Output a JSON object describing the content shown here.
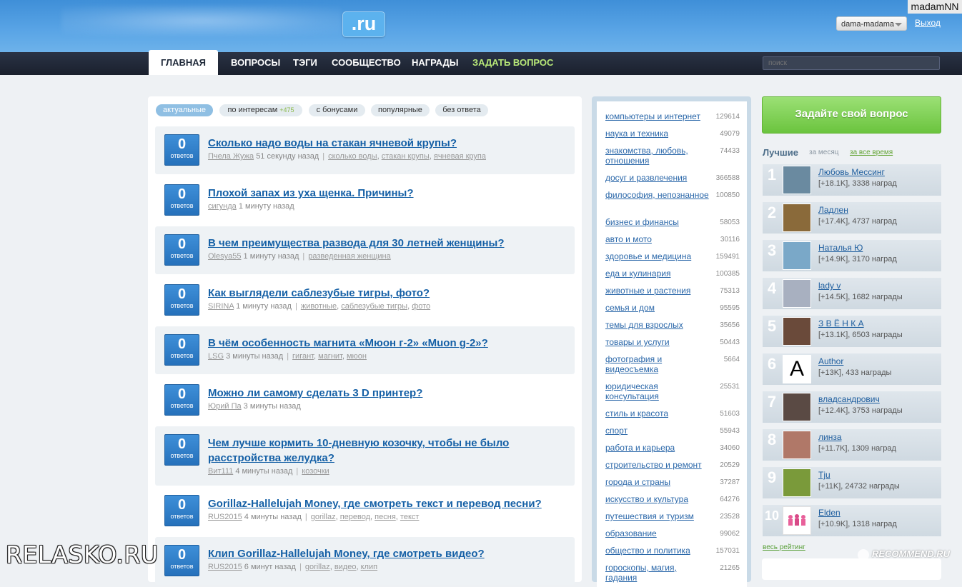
{
  "header": {
    "logo_tld": ".ru",
    "watermark_user": "madamNN",
    "user_menu_label": "dama-madama",
    "logout_label": "Выход"
  },
  "nav": {
    "home": "Главная",
    "questions": "Вопросы",
    "tags": "Тэги",
    "community": "Сообщество",
    "awards": "Награды",
    "ask": "Задать вопрос",
    "search_placeholder": "поиск"
  },
  "filters": {
    "actual": "актуальные",
    "interests": "по интересам",
    "interests_count": "+475",
    "bonus": "с бонусами",
    "popular": "популярные",
    "unanswered": "без ответа"
  },
  "questions": [
    {
      "answers": "0",
      "answers_label": "ответов",
      "title": "Сколько надо воды на стакан ячневой крупы?",
      "author": "Пчела Жужа",
      "time": "51 секунду назад",
      "tags": [
        "сколько воды",
        "стакан крупы",
        "ячневая крупа"
      ]
    },
    {
      "answers": "0",
      "answers_label": "ответов",
      "title": "Плохой запах из уха щенка. Причины?",
      "author": "сигунда",
      "time": "1 минуту назад",
      "tags": []
    },
    {
      "answers": "0",
      "answers_label": "ответов",
      "title": "В чем преимущества развода для 30 летней женщины?",
      "author": "Olesya55",
      "time": "1 минуту назад",
      "tags": [
        "разведенная женщина"
      ]
    },
    {
      "answers": "0",
      "answers_label": "ответов",
      "title": "Как выглядели саблезубые тигры, фото?",
      "author": "SIRINA",
      "time": "1 минуту назад",
      "tags": [
        "животные",
        "саблезубые тигры",
        "фото"
      ]
    },
    {
      "answers": "0",
      "answers_label": "ответов",
      "title": "В чём особенность магнита «Мюон г-2» «Muon g-2»?",
      "author": "LSG",
      "time": "3 минуты назад",
      "tags": [
        "гигант",
        "магнит",
        "мюон"
      ]
    },
    {
      "answers": "0",
      "answers_label": "ответов",
      "title": "Можно ли самому сделать 3 D принтер?",
      "author": "Юрий Па",
      "time": "3 минуты назад",
      "tags": []
    },
    {
      "answers": "0",
      "answers_label": "ответов",
      "title": "Чем лучше кормить 10-дневную козочку, чтобы не было расстройства желудка?",
      "author": "Вит111",
      "time": "4 минуты назад",
      "tags": [
        "козочки"
      ]
    },
    {
      "answers": "0",
      "answers_label": "ответов",
      "title": "Gorillaz-Hallelujah Money, где смотреть текст и перевод песни?",
      "author": "RUS2015",
      "time": "4 минуты назад",
      "tags": [
        "gorillaz",
        "перевод",
        "песня",
        "текст"
      ]
    },
    {
      "answers": "0",
      "answers_label": "ответов",
      "title": "Клип Gorillaz-Hallelujah Money, где смотреть видео?",
      "author": "RUS2015",
      "time": "6 минут назад",
      "tags": [
        "gorillaz",
        "видео",
        "клип"
      ]
    }
  ],
  "categories": [
    {
      "name": "компьютеры и интернет",
      "count": "129614"
    },
    {
      "name": "наука и техника",
      "count": "49079"
    },
    {
      "name": "знакомства, любовь, отношения",
      "count": "74433"
    },
    {
      "name": "досуг и развлечения",
      "count": "366588"
    },
    {
      "name": "философия, непознанное",
      "count": "100850"
    },
    {
      "name": "бизнес и финансы",
      "count": "58053"
    },
    {
      "name": "авто и мото",
      "count": "30116"
    },
    {
      "name": "здоровье и медицина",
      "count": "159491"
    },
    {
      "name": "еда и кулинария",
      "count": "100385"
    },
    {
      "name": "животные и растения",
      "count": "75313"
    },
    {
      "name": "семья и дом",
      "count": "95595"
    },
    {
      "name": "темы для взрослых",
      "count": "35656"
    },
    {
      "name": "товары и услуги",
      "count": "50443"
    },
    {
      "name": "фотография и видеосъемка",
      "count": "5664"
    },
    {
      "name": "юридическая консультация",
      "count": "25531"
    },
    {
      "name": "стиль и красота",
      "count": "51603"
    },
    {
      "name": "спорт",
      "count": "55943"
    },
    {
      "name": "работа и карьера",
      "count": "34060"
    },
    {
      "name": "строительство и ремонт",
      "count": "20529"
    },
    {
      "name": "города и страны",
      "count": "37287"
    },
    {
      "name": "искусство и культура",
      "count": "64276"
    },
    {
      "name": "путешествия и туризм",
      "count": "23528"
    },
    {
      "name": "образование",
      "count": "99062"
    },
    {
      "name": "общество и политика",
      "count": "157031"
    },
    {
      "name": "гороскопы, магия, гадания",
      "count": "21265"
    }
  ],
  "sidebar": {
    "ask_button": "Задайте свой вопрос",
    "best_label": "Лучшие",
    "period_month": "за месяц",
    "period_all": "за все время",
    "full_rating": "весь рейтинг"
  },
  "leaders": [
    {
      "rank": "1",
      "name": "Любовь Мессинг",
      "stats": "[+18.1K], 3338 наград",
      "avatar_color": "#6a8aa0"
    },
    {
      "rank": "2",
      "name": "Ладлен",
      "stats": "[+17.4K], 4737 наград",
      "avatar_color": "#8a6a3a"
    },
    {
      "rank": "3",
      "name": "Наталья Ю",
      "stats": "[+14.9K], 3170 наград",
      "avatar_color": "#7aa8c8"
    },
    {
      "rank": "4",
      "name": "lady v",
      "stats": "[+14.5K], 1682 награды",
      "avatar_color": "#a8b0c0"
    },
    {
      "rank": "5",
      "name": "З В Ё Н К А",
      "stats": "[+13.1K], 6503 награды",
      "avatar_color": "#6a4a3a"
    },
    {
      "rank": "6",
      "name": "Author",
      "stats": "[+13K], 433 награды",
      "avatar_letter": "A",
      "avatar_color": "#ffffff"
    },
    {
      "rank": "7",
      "name": "владсандрович",
      "stats": "[+12.4K], 3753 награды",
      "avatar_color": "#5a4a44"
    },
    {
      "rank": "8",
      "name": "линза",
      "stats": "[+11.7K], 1309 наград",
      "avatar_color": "#b07868"
    },
    {
      "rank": "9",
      "name": "Tju",
      "stats": "[+11K], 24732 награды",
      "avatar_color": "#7a9a3a"
    },
    {
      "rank": "10",
      "name": "Elden",
      "stats": "[+10.9K], 1318 наград",
      "avatar_color": "#e878a8"
    }
  ],
  "watermarks": {
    "left": "RELASKO.RU",
    "right": "RECOMMEND.RU"
  }
}
